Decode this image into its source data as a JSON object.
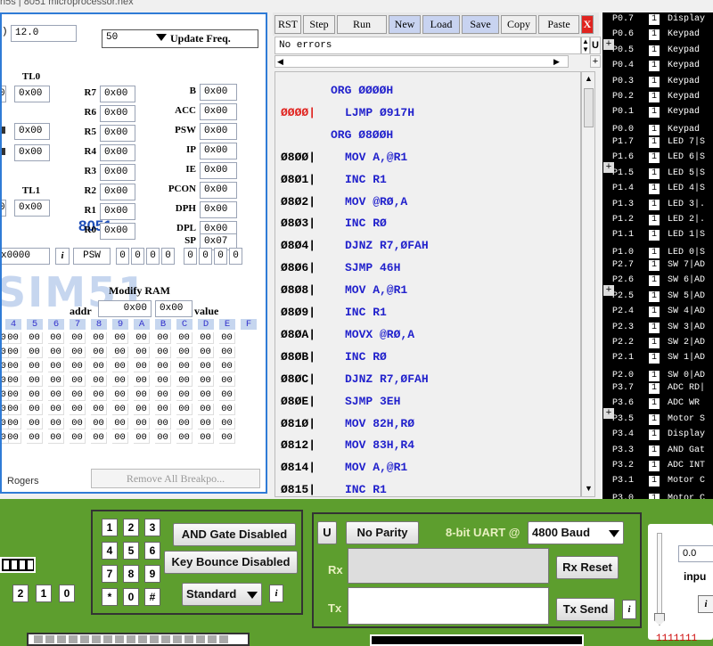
{
  "window": {
    "title": "h5s | 8051 microprocessor.hex"
  },
  "left": {
    "freq_value": "12.0",
    "freq_paren": ")",
    "freq_select": "50",
    "update_freq": "Update Freq.",
    "tl0": "TL0",
    "tl1": "TL1",
    "tl0_left": "0",
    "tl0_val": "0x00",
    "tl1_left": "0",
    "tl1_val": "0x00",
    "side_cut_1": "0x00",
    "side_cut_2": "0x00",
    "regs_mid": [
      {
        "name": "R7",
        "val": "0x00"
      },
      {
        "name": "R6",
        "val": "0x00"
      },
      {
        "name": "R5",
        "val": "0x00"
      },
      {
        "name": "R4",
        "val": "0x00"
      },
      {
        "name": "R3",
        "val": "0x00"
      },
      {
        "name": "R2",
        "val": "0x00"
      },
      {
        "name": "R1",
        "val": "0x00"
      },
      {
        "name": "R0",
        "val": "0x00"
      }
    ],
    "regs_right": [
      {
        "name": "B",
        "val": "0x00"
      },
      {
        "name": "ACC",
        "val": "0x00"
      },
      {
        "name": "PSW",
        "val": "0x00"
      },
      {
        "name": "IP",
        "val": "0x00"
      },
      {
        "name": "IE",
        "val": "0x00"
      },
      {
        "name": "PCON",
        "val": "0x00"
      },
      {
        "name": "DPH",
        "val": "0x00"
      },
      {
        "name": "DPL",
        "val": "0x00"
      },
      {
        "name": "SP",
        "val": "0x07"
      }
    ],
    "chip": "8051",
    "pc_val": "x0000",
    "info": "i",
    "psw_label": "PSW",
    "psw_bits": [
      "0",
      "0",
      "0",
      "0",
      "0",
      "0",
      "0",
      "0"
    ],
    "logo": "SIM51",
    "modify_ram": "Modify RAM",
    "addr_label": "addr",
    "addr_val": "0x00",
    "value_val": "0x00",
    "value_label": "value",
    "hex_header": [
      "4",
      "5",
      "6",
      "7",
      "8",
      "9",
      "A",
      "B",
      "C",
      "D",
      "E",
      "F"
    ],
    "hex_cell": "00",
    "author": "Rogers",
    "remove_bp": "Remove All Breakpo..."
  },
  "code": {
    "buttons": {
      "rst": "RST",
      "step": "Step",
      "run": "Run",
      "new": "New",
      "load": "Load",
      "save": "Save",
      "copy": "Copy",
      "paste": "Paste",
      "close": "X"
    },
    "status": "No errors",
    "u": "U",
    "plus": "+",
    "lines": [
      {
        "addr": "",
        "ins": "ORG ØØØØH",
        "bp": false
      },
      {
        "addr": "ØØØØ|",
        "ins": "LJMP Ø917H",
        "bp": true
      },
      {
        "addr": "",
        "ins": "ORG Ø8ØØH",
        "bp": false
      },
      {
        "addr": "Ø8ØØ|",
        "ins": "MOV A,@R1",
        "bp": false
      },
      {
        "addr": "Ø8Ø1|",
        "ins": "INC R1",
        "bp": false
      },
      {
        "addr": "Ø8Ø2|",
        "ins": "MOV @RØ,A",
        "bp": false
      },
      {
        "addr": "Ø8Ø3|",
        "ins": "INC RØ",
        "bp": false
      },
      {
        "addr": "Ø8Ø4|",
        "ins": "DJNZ R7,ØFAH",
        "bp": false
      },
      {
        "addr": "Ø8Ø6|",
        "ins": "SJMP 46H",
        "bp": false
      },
      {
        "addr": "Ø8Ø8|",
        "ins": "MOV A,@R1",
        "bp": false
      },
      {
        "addr": "Ø8Ø9|",
        "ins": "INC R1",
        "bp": false
      },
      {
        "addr": "Ø8ØA|",
        "ins": "MOVX @RØ,A",
        "bp": false
      },
      {
        "addr": "Ø8ØB|",
        "ins": "INC RØ",
        "bp": false
      },
      {
        "addr": "Ø8ØC|",
        "ins": "DJNZ R7,ØFAH",
        "bp": false
      },
      {
        "addr": "Ø8ØE|",
        "ins": "SJMP 3EH",
        "bp": false
      },
      {
        "addr": "Ø81Ø|",
        "ins": "MOV 82H,RØ",
        "bp": false
      },
      {
        "addr": "Ø812|",
        "ins": "MOV 83H,R4",
        "bp": false
      },
      {
        "addr": "Ø814|",
        "ins": "MOV A,@R1",
        "bp": false
      },
      {
        "addr": "Ø815|",
        "ins": "INC R1",
        "bp": false
      }
    ]
  },
  "pins": {
    "plus": "+",
    "rows": [
      {
        "p": "P0.7",
        "v": "1",
        "d": "Display"
      },
      {
        "p": "P0.6",
        "v": "1",
        "d": "Keypad"
      },
      {
        "p": "P0.5",
        "v": "1",
        "d": "Keypad"
      },
      {
        "p": "P0.4",
        "v": "1",
        "d": "Keypad"
      },
      {
        "p": "P0.3",
        "v": "1",
        "d": "Keypad"
      },
      {
        "p": "P0.2",
        "v": "1",
        "d": "Keypad"
      },
      {
        "p": "P0.1",
        "v": "1",
        "d": "Keypad"
      },
      {
        "p": "P0.0",
        "v": "1",
        "d": "Keypad"
      },
      {
        "p": "P1.7",
        "v": "1",
        "d": "LED 7|S"
      },
      {
        "p": "P1.6",
        "v": "1",
        "d": "LED 6|S"
      },
      {
        "p": "P1.5",
        "v": "1",
        "d": "LED 5|S"
      },
      {
        "p": "P1.4",
        "v": "1",
        "d": "LED 4|S"
      },
      {
        "p": "P1.3",
        "v": "1",
        "d": "LED 3|."
      },
      {
        "p": "P1.2",
        "v": "1",
        "d": "LED 2|."
      },
      {
        "p": "P1.1",
        "v": "1",
        "d": "LED 1|S"
      },
      {
        "p": "P1.0",
        "v": "1",
        "d": "LED 0|S"
      },
      {
        "p": "P2.7",
        "v": "1",
        "d": "SW 7|AD"
      },
      {
        "p": "P2.6",
        "v": "1",
        "d": "SW 6|AD"
      },
      {
        "p": "P2.5",
        "v": "1",
        "d": "SW 5|AD"
      },
      {
        "p": "P2.4",
        "v": "1",
        "d": "SW 4|AD"
      },
      {
        "p": "P2.3",
        "v": "1",
        "d": "SW 3|AD"
      },
      {
        "p": "P2.2",
        "v": "1",
        "d": "SW 2|AD"
      },
      {
        "p": "P2.1",
        "v": "1",
        "d": "SW 1|AD"
      },
      {
        "p": "P2.0",
        "v": "1",
        "d": "SW 0|AD"
      },
      {
        "p": "P3.7",
        "v": "1",
        "d": "ADC RD|"
      },
      {
        "p": "P3.6",
        "v": "1",
        "d": "ADC WR"
      },
      {
        "p": "P3.5",
        "v": "1",
        "d": "Motor S"
      },
      {
        "p": "P3.4",
        "v": "1",
        "d": "Display"
      },
      {
        "p": "P3.3",
        "v": "1",
        "d": "AND Gat"
      },
      {
        "p": "P3.2",
        "v": "1",
        "d": "ADC INT"
      },
      {
        "p": "P3.1",
        "v": "1",
        "d": "Motor C"
      },
      {
        "p": "P3.0",
        "v": "1",
        "d": "Motor C"
      }
    ]
  },
  "bottom": {
    "keypad": [
      "1",
      "2",
      "3",
      "4",
      "5",
      "6",
      "7",
      "8",
      "9",
      "*",
      "0",
      "#"
    ],
    "and_gate": "AND Gate Disabled",
    "key_bounce": "Key Bounce Disabled",
    "standard": "Standard",
    "info": "i",
    "digits": [
      "2",
      "1",
      "0"
    ],
    "uart_u": "U",
    "parity": "No Parity",
    "uart_label": "8-bit UART @",
    "baud": "4800 Baud",
    "rx": "Rx",
    "tx": "Tx",
    "rx_reset": "Rx Reset",
    "tx_send": "Tx Send",
    "right_val": "0.0",
    "right_label": "inpu",
    "right_info": "i",
    "bits": "1111111"
  }
}
